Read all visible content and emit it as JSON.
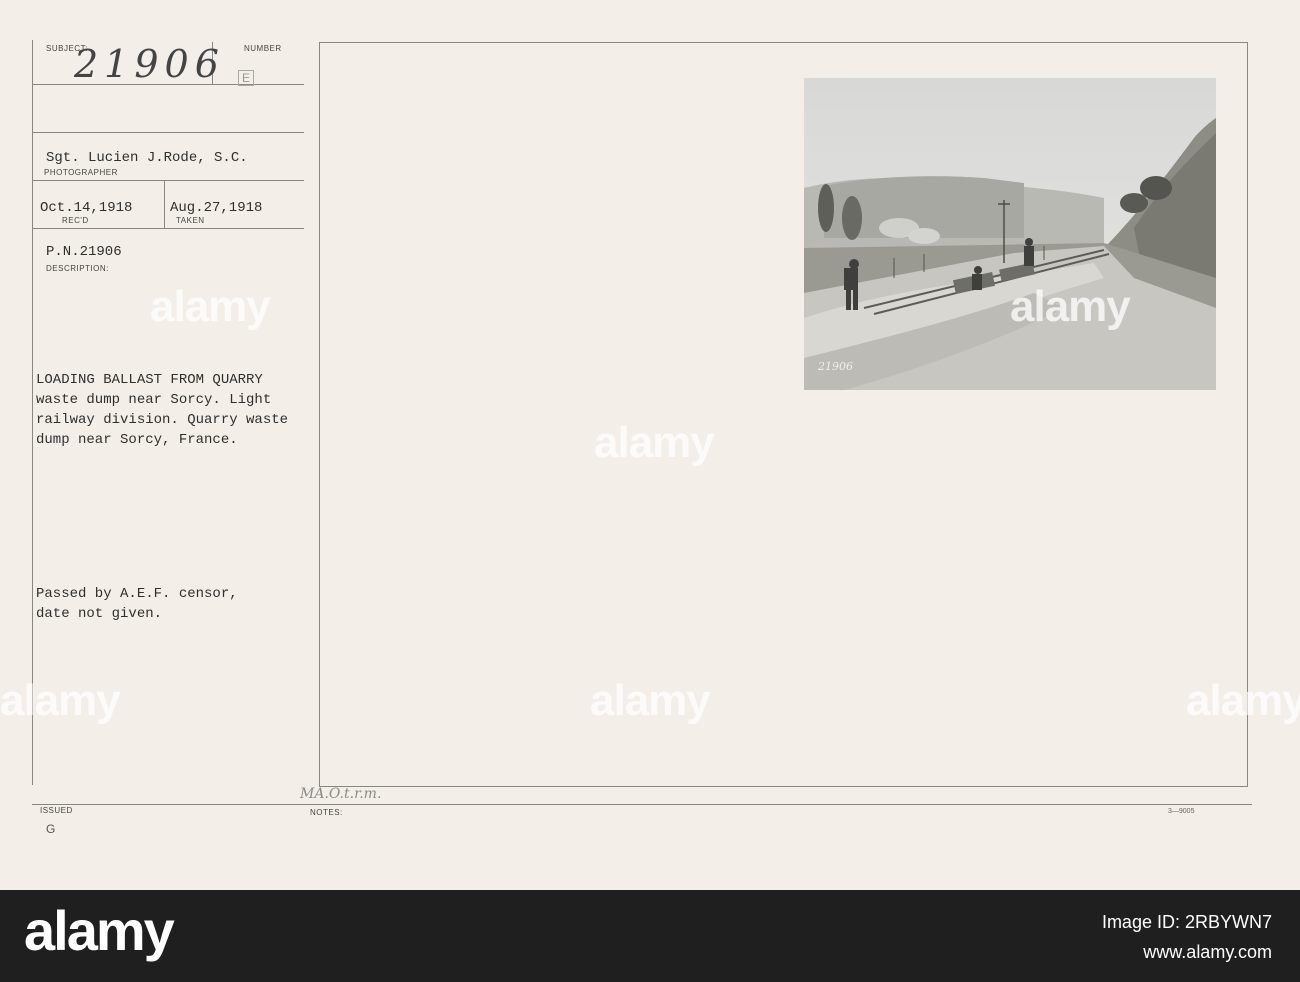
{
  "card": {
    "subject_label": "SUBJECT:",
    "subject_value": "21906",
    "number_label": "NUMBER",
    "number_mark": "E",
    "photographer_value": "Sgt. Lucien J.Rode, S.C.",
    "photographer_label": "PHOTOGRAPHER",
    "recd_value": "Oct.14,1918",
    "recd_label": "REC'D",
    "taken_value": "Aug.27,1918",
    "taken_label": "TAKEN",
    "pn_value": "P.N.21906",
    "description_label": "DESCRIPTION:",
    "description_lines": [
      "LOADING BALLAST FROM QUARRY",
      "waste dump near Sorcy. Light",
      "railway division. Quarry waste",
      "dump near Sorcy, France."
    ],
    "censor_lines": [
      "Passed by A.E.F. censor,",
      "date not given."
    ],
    "issued_label": "ISSUED",
    "issued_value": "G",
    "notes_label": "NOTES:",
    "notes_handwriting": "MA.O.t.r.m.",
    "form_number": "3—9005",
    "photo_caption_number": "21906"
  },
  "watermarks": [
    "alamy",
    "alamy",
    "alamy",
    "alamy",
    "alamy",
    "alamy"
  ],
  "footer": {
    "brand": "alamy",
    "image_id_label": "Image ID: 2RBYWN7",
    "site": "www.alamy.com"
  }
}
